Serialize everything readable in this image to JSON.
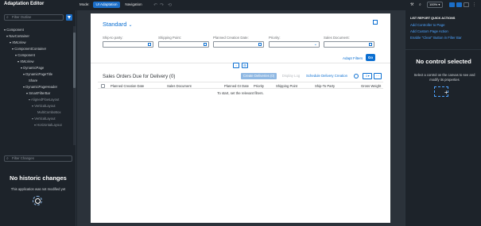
{
  "shell": {
    "title": "Adaptation Editor",
    "mode_label": "Mode:",
    "mode_ui_adaptation": "UI Adaptation",
    "mode_navigation": "Navigation",
    "zoom": "100%"
  },
  "outline": {
    "filter_placeholder": "Filter Outline",
    "items": [
      {
        "label": "Component"
      },
      {
        "label": "NavContainer"
      },
      {
        "label": "XMLView"
      },
      {
        "label": "ComponentContainer"
      },
      {
        "label": "Component"
      },
      {
        "label": "XMLView"
      },
      {
        "label": "DynamicPage"
      },
      {
        "label": "DynamicPageTitle"
      },
      {
        "label": "Share"
      },
      {
        "label": "DynamicPageHeader"
      },
      {
        "label": "SmartFilterBar"
      },
      {
        "label": "AlignedFlowLayout"
      },
      {
        "label": "VerticalLayout"
      },
      {
        "label": "MultiComboBox"
      },
      {
        "label": "VerticalLayout"
      },
      {
        "label": "HorizontalLayout"
      }
    ]
  },
  "changes": {
    "filter_placeholder": "Filter Changes",
    "title": "No historic changes",
    "subtitle": "This application was not modified yet"
  },
  "app": {
    "variant": "Standard",
    "filters": [
      {
        "label": "Ship-to party:",
        "control": "valuehelp"
      },
      {
        "label": "Shipping Point:",
        "control": "valuehelp"
      },
      {
        "label": "Planned Creation Date:",
        "control": "date"
      },
      {
        "label": "Priority:",
        "control": "select"
      },
      {
        "label": "Sales Document:",
        "control": "valuehelp"
      }
    ],
    "adapt_filters": "Adapt Filters",
    "go": "Go",
    "table": {
      "title": "Sales Orders Due for Delivery (0)",
      "create_deliveries": "Create Deliveries (0)",
      "display_log": "Display Log",
      "schedule_delivery": "Schedule Delivery Creation",
      "columns": [
        "Planned Creation Date",
        "Sales Document",
        "Planned GI Date",
        "Priority",
        "Shipping Point",
        "Ship-To Party",
        "Gross Weight"
      ],
      "empty_text": "To start, set the relevant filters."
    }
  },
  "quick_actions": {
    "heading": "LIST REPORT QUICK ACTIONS",
    "links": [
      "Add Controller to Page",
      "Add Custom Page Action",
      "Enable \"Clear\" Button in Filter Bar"
    ]
  },
  "properties": {
    "title": "No control selected",
    "subtitle": "Select a control on the canvas to see and modify its properties"
  },
  "colors": {
    "accent": "#1b6ec8",
    "link": "#4da3ff",
    "background": "#1d232a"
  }
}
